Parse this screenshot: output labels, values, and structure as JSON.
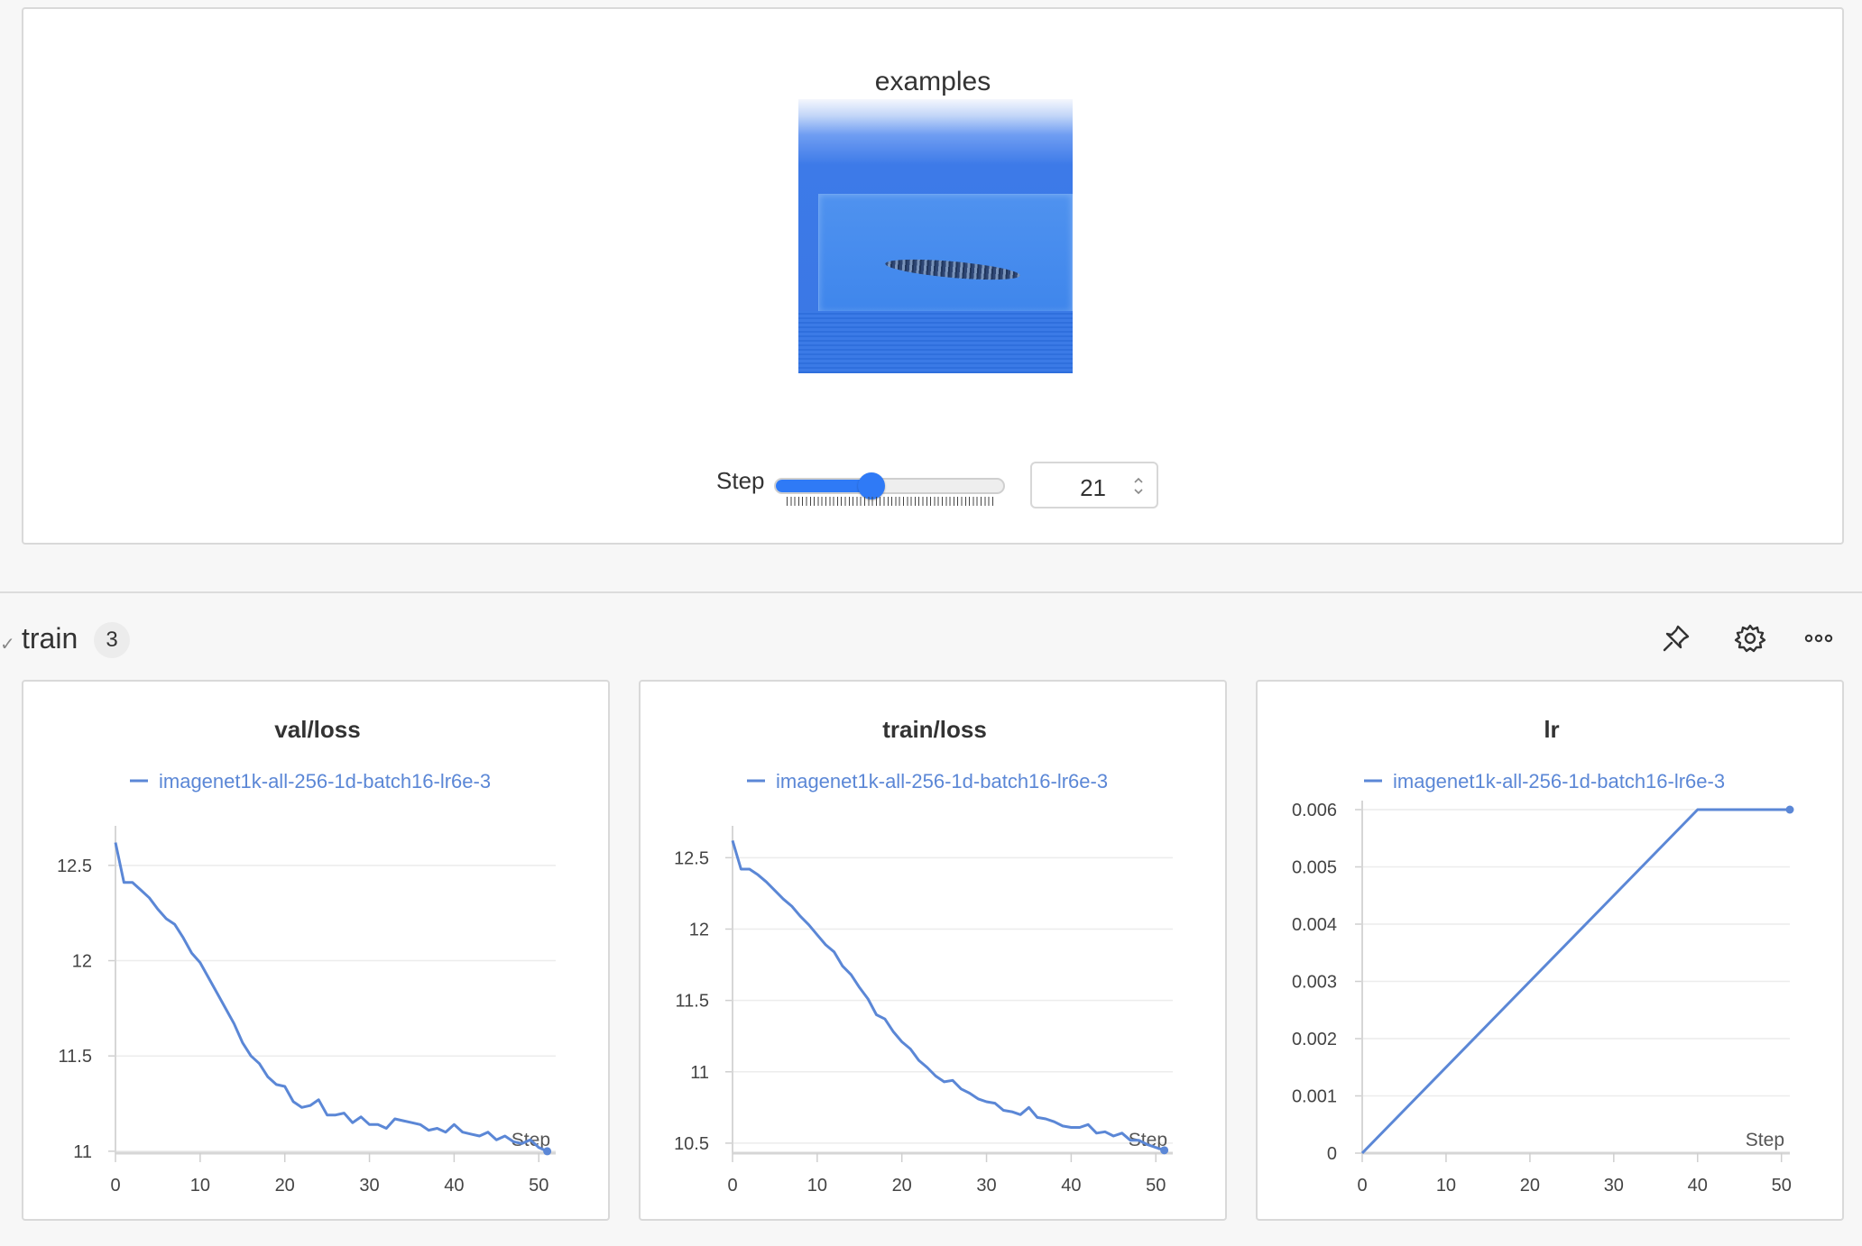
{
  "media": {
    "title": "examples",
    "image_alt": "Generated sample: blue water tank with a fish",
    "step_label": "Step",
    "slider_value_fraction": 0.42,
    "step_value": "21"
  },
  "section": {
    "title": "train",
    "count": "3",
    "tools": [
      "pin-icon",
      "gear-icon",
      "more-icon"
    ]
  },
  "colors": {
    "accent": "#2f7af6",
    "series": "#5b87d6"
  },
  "chart_data": [
    {
      "type": "line",
      "title": "val/loss",
      "xlabel": "Step",
      "legend": [
        "imagenet1k-all-256-1d-batch16-lr6e-3"
      ],
      "xlim": [
        0,
        52
      ],
      "ylim": [
        10.99,
        12.66
      ],
      "xticks": [
        0,
        10,
        20,
        30,
        40,
        50
      ],
      "xtick_labels": [
        "0",
        "10",
        "20",
        "30",
        "40",
        "50"
      ],
      "yticks": [
        11,
        11.5,
        12,
        12.5
      ],
      "ytick_labels": [
        "11",
        "11.5",
        "12",
        "12.5"
      ],
      "series": [
        {
          "name": "imagenet1k-all-256-1d-batch16-lr6e-3",
          "x": [
            0,
            1,
            2,
            3,
            4,
            5,
            6,
            7,
            8,
            9,
            10,
            11,
            12,
            13,
            14,
            15,
            16,
            17,
            18,
            19,
            20,
            21,
            22,
            23,
            24,
            25,
            26,
            27,
            28,
            29,
            30,
            31,
            32,
            33,
            34,
            35,
            36,
            37,
            38,
            39,
            40,
            41,
            42,
            43,
            44,
            45,
            46,
            47,
            48,
            49,
            50,
            51
          ],
          "values": [
            12.62,
            12.41,
            12.41,
            12.37,
            12.33,
            12.27,
            12.22,
            12.19,
            12.12,
            12.04,
            11.99,
            11.91,
            11.83,
            11.75,
            11.67,
            11.57,
            11.5,
            11.46,
            11.39,
            11.35,
            11.34,
            11.26,
            11.23,
            11.24,
            11.27,
            11.19,
            11.19,
            11.2,
            11.15,
            11.18,
            11.14,
            11.14,
            11.12,
            11.17,
            11.16,
            11.15,
            11.14,
            11.11,
            11.12,
            11.1,
            11.14,
            11.1,
            11.09,
            11.08,
            11.1,
            11.06,
            11.08,
            11.05,
            11.04,
            11.06,
            11.02,
            11.0
          ]
        }
      ]
    },
    {
      "type": "line",
      "title": "train/loss",
      "xlabel": "Step",
      "legend": [
        "imagenet1k-all-256-1d-batch16-lr6e-3"
      ],
      "xlim": [
        0,
        52
      ],
      "ylim": [
        10.43,
        12.66
      ],
      "xticks": [
        0,
        10,
        20,
        30,
        40,
        50
      ],
      "xtick_labels": [
        "0",
        "10",
        "20",
        "30",
        "40",
        "50"
      ],
      "yticks": [
        10.5,
        11,
        11.5,
        12,
        12.5
      ],
      "ytick_labels": [
        "10.5",
        "11",
        "11.5",
        "12",
        "12.5"
      ],
      "series": [
        {
          "name": "imagenet1k-all-256-1d-batch16-lr6e-3",
          "x": [
            0,
            1,
            2,
            3,
            4,
            5,
            6,
            7,
            8,
            9,
            10,
            11,
            12,
            13,
            14,
            15,
            16,
            17,
            18,
            19,
            20,
            21,
            22,
            23,
            24,
            25,
            26,
            27,
            28,
            29,
            30,
            31,
            32,
            33,
            34,
            35,
            36,
            37,
            38,
            39,
            40,
            41,
            42,
            43,
            44,
            45,
            46,
            47,
            48,
            49,
            50,
            51
          ],
          "values": [
            12.62,
            12.42,
            12.42,
            12.38,
            12.33,
            12.27,
            12.21,
            12.16,
            12.09,
            12.03,
            11.96,
            11.89,
            11.84,
            11.74,
            11.68,
            11.59,
            11.51,
            11.4,
            11.37,
            11.28,
            11.21,
            11.16,
            11.08,
            11.03,
            10.97,
            10.93,
            10.94,
            10.88,
            10.85,
            10.81,
            10.79,
            10.78,
            10.73,
            10.72,
            10.7,
            10.75,
            10.68,
            10.67,
            10.65,
            10.62,
            10.61,
            10.61,
            10.63,
            10.57,
            10.58,
            10.55,
            10.57,
            10.52,
            10.52,
            10.49,
            10.47,
            10.45
          ]
        }
      ]
    },
    {
      "type": "line",
      "title": "lr",
      "xlabel": "Step",
      "legend": [
        "imagenet1k-all-256-1d-batch16-lr6e-3"
      ],
      "xlim": [
        0,
        51
      ],
      "ylim": [
        0,
        0.006
      ],
      "xticks": [
        0,
        10,
        20,
        30,
        40,
        50
      ],
      "xtick_labels": [
        "0",
        "10",
        "20",
        "30",
        "40",
        "50"
      ],
      "yticks": [
        0,
        0.001,
        0.002,
        0.003,
        0.004,
        0.005,
        0.006
      ],
      "ytick_labels": [
        "0",
        "0.001",
        "0.002",
        "0.003",
        "0.004",
        "0.005",
        "0.006"
      ],
      "series": [
        {
          "name": "imagenet1k-all-256-1d-batch16-lr6e-3",
          "x": [
            0,
            40,
            51
          ],
          "values": [
            0,
            0.006,
            0.006
          ]
        }
      ]
    }
  ]
}
